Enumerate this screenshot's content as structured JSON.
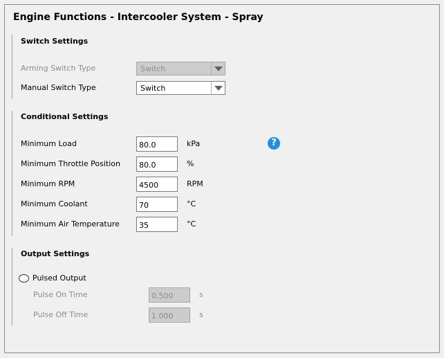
{
  "title": "Engine Functions - Intercooler System - Spray",
  "switch_settings": {
    "heading": "Switch Settings",
    "arming_label": "Arming Switch Type",
    "arming_value": "Switch",
    "manual_label": "Manual Switch Type",
    "manual_value": "Switch"
  },
  "conditional_settings": {
    "heading": "Conditional Settings",
    "help_icon": "?",
    "rows": [
      {
        "label": "Minimum Load",
        "value": "80.0",
        "unit": "kPa"
      },
      {
        "label": "Minimum Throttle Position",
        "value": "80.0",
        "unit": "%"
      },
      {
        "label": "Minimum RPM",
        "value": "4500",
        "unit": "RPM"
      },
      {
        "label": "Minimum Coolant",
        "value": "70",
        "unit": "°C"
      },
      {
        "label": "Minimum Air Temperature",
        "value": "35",
        "unit": "°C"
      }
    ]
  },
  "output_settings": {
    "heading": "Output Settings",
    "pulsed_label": "Pulsed Output",
    "pulsed_checked": false,
    "on_label": "Pulse On Time",
    "on_value": "0.500",
    "on_unit": "s",
    "off_label": "Pulse Off Time",
    "off_value": "1.000",
    "off_unit": "s"
  },
  "colors": {
    "background": "#f0f0f0",
    "disabled_field": "#cccccc",
    "help_icon": "#1e90e8"
  }
}
